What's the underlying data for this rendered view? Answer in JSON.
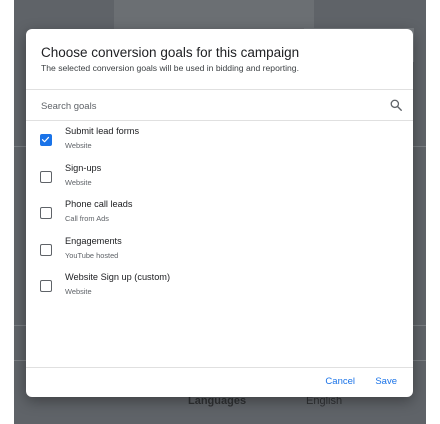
{
  "background_page": {
    "labels": [
      "Languages",
      "English"
    ]
  },
  "dialog": {
    "title": "Choose conversion goals for this campaign",
    "subtitle": "The selected conversion goals will be used in bidding and reporting.",
    "search": {
      "placeholder": "Search goals",
      "value": ""
    },
    "goals": [
      {
        "name": "Submit lead forms",
        "source": "Website",
        "checked": true
      },
      {
        "name": "Sign-ups",
        "source": "Website",
        "checked": false
      },
      {
        "name": "Phone call leads",
        "source": "Call from Ads",
        "checked": false
      },
      {
        "name": "Engagements",
        "source": "YouTube hosted",
        "checked": false
      },
      {
        "name": "Website Sign up (custom)",
        "source": "Website",
        "checked": false
      }
    ],
    "footer": {
      "cancel_label": "Cancel",
      "save_label": "Save"
    }
  },
  "colors": {
    "accent": "#1a73e8",
    "scrim": "#5f6368"
  },
  "icons": {
    "search": "search-icon",
    "checkbox_checked": "checkmark-icon"
  }
}
